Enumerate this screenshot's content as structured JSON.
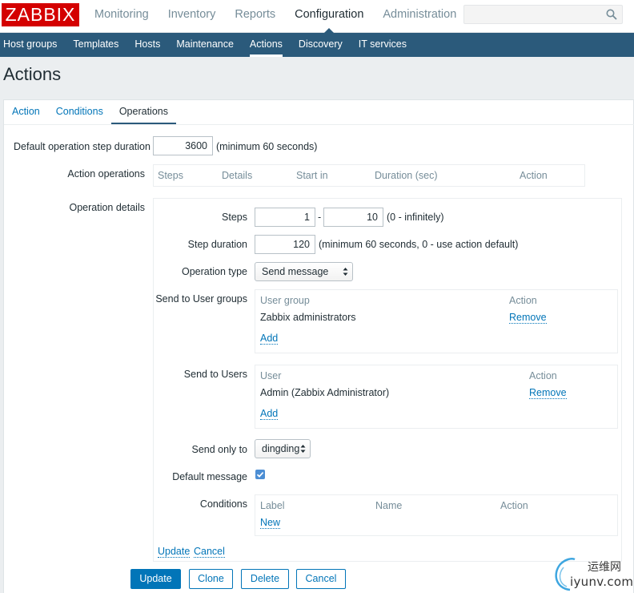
{
  "header": {
    "logo_text": "ZABBIX",
    "main_nav": [
      "Monitoring",
      "Inventory",
      "Reports",
      "Configuration",
      "Administration"
    ],
    "active_main": "Configuration",
    "search_placeholder": ""
  },
  "subnav": {
    "items": [
      "Host groups",
      "Templates",
      "Hosts",
      "Maintenance",
      "Actions",
      "Discovery",
      "IT services"
    ],
    "active": "Actions"
  },
  "page": {
    "title": "Actions"
  },
  "tabs": {
    "items": [
      "Action",
      "Conditions",
      "Operations"
    ],
    "active": "Operations"
  },
  "form": {
    "step_duration_label": "Default operation step duration",
    "step_duration_value": "3600",
    "step_duration_hint": "(minimum 60 seconds)",
    "action_operations_label": "Action operations",
    "action_operations_columns": [
      "Steps",
      "Details",
      "Start in",
      "Duration (sec)",
      "Action"
    ],
    "operation_details_label": "Operation details",
    "steps_label": "Steps",
    "steps_from": "1",
    "steps_sep": "-",
    "steps_to": "10",
    "steps_hint": "(0 - infinitely)",
    "op_step_duration_label": "Step duration",
    "op_step_duration_value": "120",
    "op_step_duration_hint": "(minimum 60 seconds, 0 - use action default)",
    "operation_type_label": "Operation type",
    "operation_type_value": "Send message",
    "user_groups_label": "Send to User groups",
    "user_groups_columns": [
      "User group",
      "Action"
    ],
    "user_groups_rows": [
      {
        "name": "Zabbix administrators",
        "action": "Remove"
      }
    ],
    "user_groups_add": "Add",
    "users_label": "Send to Users",
    "users_columns": [
      "User",
      "Action"
    ],
    "users_rows": [
      {
        "name": "Admin (Zabbix Administrator)",
        "action": "Remove"
      }
    ],
    "users_add": "Add",
    "send_only_to_label": "Send only to",
    "send_only_to_value": "dingding",
    "default_message_label": "Default message",
    "default_message_checked": true,
    "conditions_label": "Conditions",
    "conditions_columns": [
      "Label",
      "Name",
      "Action"
    ],
    "conditions_new": "New",
    "op_update": "Update",
    "op_cancel": "Cancel"
  },
  "buttons": {
    "update": "Update",
    "clone": "Clone",
    "delete": "Delete",
    "cancel": "Cancel"
  },
  "watermark": {
    "cn": "运维网",
    "en": "iyunv.com"
  },
  "colors": {
    "brand": "#d40000",
    "subnav": "#2b5a7b",
    "link": "#0275b8",
    "primary": "#0275b8"
  }
}
